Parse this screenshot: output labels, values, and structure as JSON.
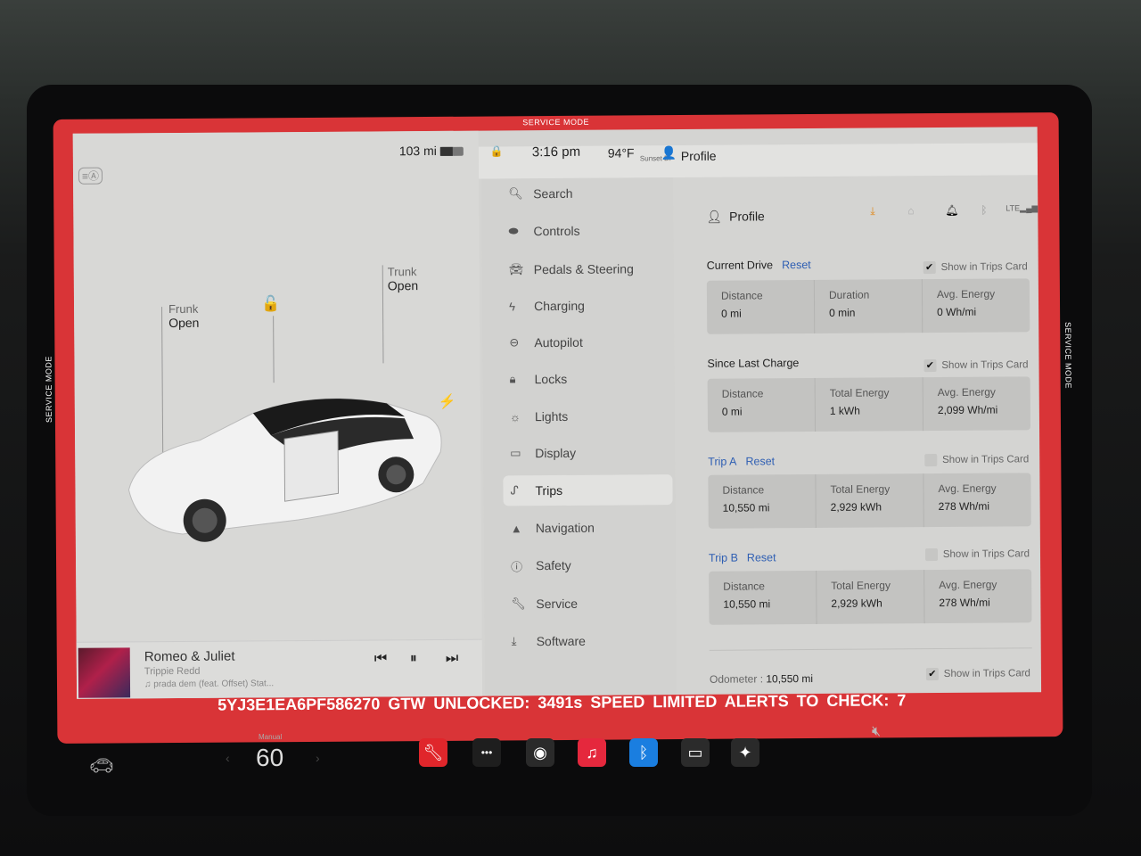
{
  "status_bar": {
    "range": "103 mi",
    "battery_level": 0.55,
    "time": "3:16 pm",
    "temperature": "94°F",
    "location": "Sunset Dr",
    "profile": "Profile"
  },
  "service_mode": {
    "banner": "SERVICE MODE"
  },
  "car_panel": {
    "frunk": {
      "label": "Frunk",
      "state": "Open"
    },
    "trunk": {
      "label": "Trunk",
      "state": "Open"
    }
  },
  "media": {
    "title": "Romeo & Juliet",
    "artist": "Trippie Redd",
    "source": "prada dem (feat. Offset) Stat..."
  },
  "nav": {
    "items": [
      {
        "label": "Search",
        "icon": "search-icon"
      },
      {
        "label": "Controls",
        "icon": "toggle-icon"
      },
      {
        "label": "Pedals & Steering",
        "icon": "car-icon"
      },
      {
        "label": "Charging",
        "icon": "bolt-icon"
      },
      {
        "label": "Autopilot",
        "icon": "steering-wheel-icon"
      },
      {
        "label": "Locks",
        "icon": "lock-icon"
      },
      {
        "label": "Lights",
        "icon": "light-icon"
      },
      {
        "label": "Display",
        "icon": "display-icon"
      },
      {
        "label": "Trips",
        "icon": "trips-icon",
        "active": true
      },
      {
        "label": "Navigation",
        "icon": "navigation-icon"
      },
      {
        "label": "Safety",
        "icon": "safety-icon"
      },
      {
        "label": "Service",
        "icon": "wrench-icon"
      },
      {
        "label": "Software",
        "icon": "download-icon"
      }
    ]
  },
  "content": {
    "profile_label": "Profile",
    "show_in_trips_label": "Show in Trips Card",
    "reset_label": "Reset",
    "sections": [
      {
        "title": "Current Drive",
        "has_reset": true,
        "show_in_card": true,
        "stats": [
          {
            "label": "Distance",
            "value": "0 mi"
          },
          {
            "label": "Duration",
            "value": "0 min"
          },
          {
            "label": "Avg. Energy",
            "value": "0 Wh/mi"
          }
        ]
      },
      {
        "title": "Since Last Charge",
        "has_reset": false,
        "show_in_card": true,
        "stats": [
          {
            "label": "Distance",
            "value": "0 mi"
          },
          {
            "label": "Total Energy",
            "value": "1 kWh"
          },
          {
            "label": "Avg. Energy",
            "value": "2,099 Wh/mi"
          }
        ]
      },
      {
        "title": "Trip A",
        "has_reset": true,
        "show_in_card": false,
        "stats": [
          {
            "label": "Distance",
            "value": "10,550 mi"
          },
          {
            "label": "Total Energy",
            "value": "2,929 kWh"
          },
          {
            "label": "Avg. Energy",
            "value": "278 Wh/mi"
          }
        ]
      },
      {
        "title": "Trip B",
        "has_reset": true,
        "show_in_card": false,
        "stats": [
          {
            "label": "Distance",
            "value": "10,550 mi"
          },
          {
            "label": "Total Energy",
            "value": "2,929 kWh"
          },
          {
            "label": "Avg. Energy",
            "value": "278 Wh/mi"
          }
        ]
      }
    ],
    "odometer": {
      "label": "Odometer :",
      "value": "10,550 mi",
      "show_in_card": true
    }
  },
  "service_bar": {
    "vin": "5YJ3E1EA6PF586270",
    "gtw": "GTW UNLOCKED: 3491s",
    "speed": "SPEED LIMITED",
    "alerts": "ALERTS TO CHECK: 7"
  },
  "dock": {
    "climate_mode": "Manual",
    "temperature_setting": "60",
    "apps": [
      {
        "name": "service-app",
        "color": "#e0262b",
        "glyph": "🔧"
      },
      {
        "name": "more-apps",
        "color": "#1e1e1e",
        "glyph": "•••"
      },
      {
        "name": "dashcam-app",
        "color": "#2a2a2a",
        "glyph": "◉"
      },
      {
        "name": "music-app",
        "color": "#e5283d",
        "glyph": "♫"
      },
      {
        "name": "bluetooth-app",
        "color": "#1a7ee0",
        "glyph": "ᛒ"
      },
      {
        "name": "calendar-app",
        "color": "#2b2b2b",
        "glyph": "▭"
      },
      {
        "name": "toybox-app",
        "color": "#2a2a2a",
        "glyph": "✦"
      }
    ],
    "volume": "muted"
  },
  "colors": {
    "service_red": "#d93437",
    "link_blue": "#2f5fb3"
  }
}
